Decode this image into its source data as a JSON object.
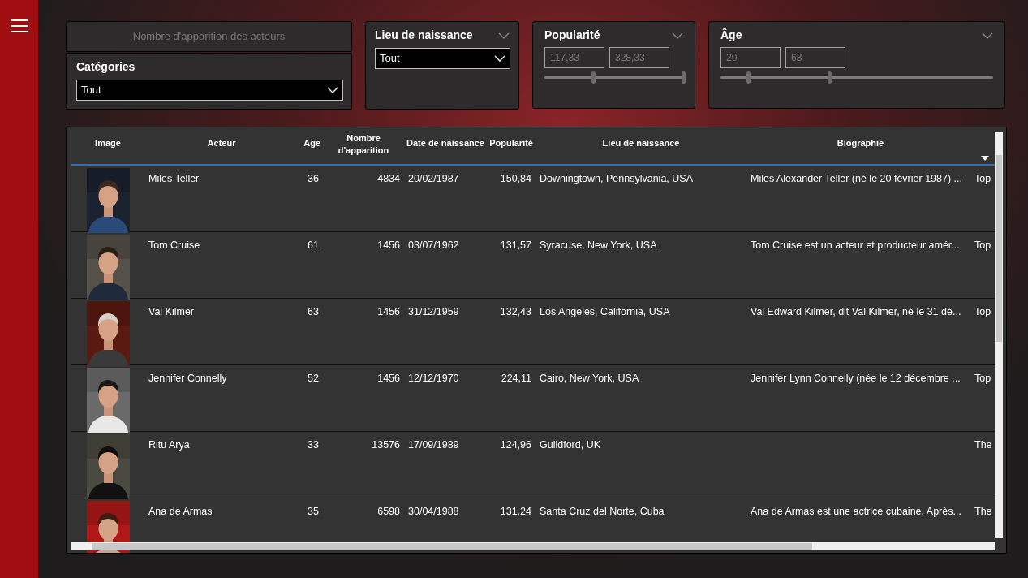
{
  "filters": {
    "measure_card": {
      "title": "Nombre d'apparition des acteurs"
    },
    "categories": {
      "title": "Catégories",
      "value": "Tout"
    },
    "birthplace": {
      "title": "Lieu de naissance",
      "value": "Tout"
    },
    "popularity": {
      "title": "Popularité",
      "low": "117,33",
      "high": "328,33",
      "thumbs": [
        {
          "level": 0.35
        },
        {
          "level": 1.0
        }
      ]
    },
    "age": {
      "title": "Âge",
      "low": "20",
      "high": "63",
      "thumbs": [
        {
          "level": 0.1
        },
        {
          "level": 0.4
        }
      ]
    }
  },
  "table": {
    "columns": [
      "Image",
      "Acteur",
      "Age",
      "Nombre d'apparition",
      "Date de naissance",
      "Popularité",
      "Lieu de naissance",
      "Biographie",
      ""
    ],
    "rows": [
      {
        "actor": "Miles Teller",
        "age": "36",
        "appearances": "4834",
        "birth_date": "20/02/1987",
        "popularity": "150,84",
        "birthplace": "Downingtown, Pennsylvania, USA",
        "biography": "Miles Alexander Teller (né le 20 février 1987) ...",
        "column_9": "Top"
      },
      {
        "actor": "Tom Cruise",
        "age": "61",
        "appearances": "1456",
        "birth_date": "03/07/1962",
        "popularity": "131,57",
        "birthplace": "Syracuse, New York, USA",
        "biography": "Tom Cruise est un acteur et producteur amér...",
        "column_9": "Top"
      },
      {
        "actor": "Val Kilmer",
        "age": "63",
        "appearances": "1456",
        "birth_date": "31/12/1959",
        "popularity": "132,43",
        "birthplace": "Los Angeles, California, USA",
        "biography": "Val Edward Kilmer, dit Val Kilmer, né le 31 dé...",
        "column_9": "Top"
      },
      {
        "actor": "Jennifer Connelly",
        "age": "52",
        "appearances": "1456",
        "birth_date": "12/12/1970",
        "popularity": "224,11",
        "birthplace": "Cairo, New York, USA",
        "biography": "Jennifer Lynn Connelly (née le 12 décembre ...",
        "column_9": "Top"
      },
      {
        "actor": "Ritu Arya",
        "age": "33",
        "appearances": "13576",
        "birth_date": "17/09/1989",
        "popularity": "124,96",
        "birthplace": "Guildford, UK",
        "biography": "",
        "column_9": "The"
      },
      {
        "actor": "Ana de Armas",
        "age": "35",
        "appearances": "6598",
        "birth_date": "30/04/1988",
        "popularity": "131,24",
        "birthplace": "Santa Cruz del Norte, Cuba",
        "biography": "Ana de Armas est une actrice cubaine. Après...",
        "column_9": "The"
      }
    ]
  }
}
